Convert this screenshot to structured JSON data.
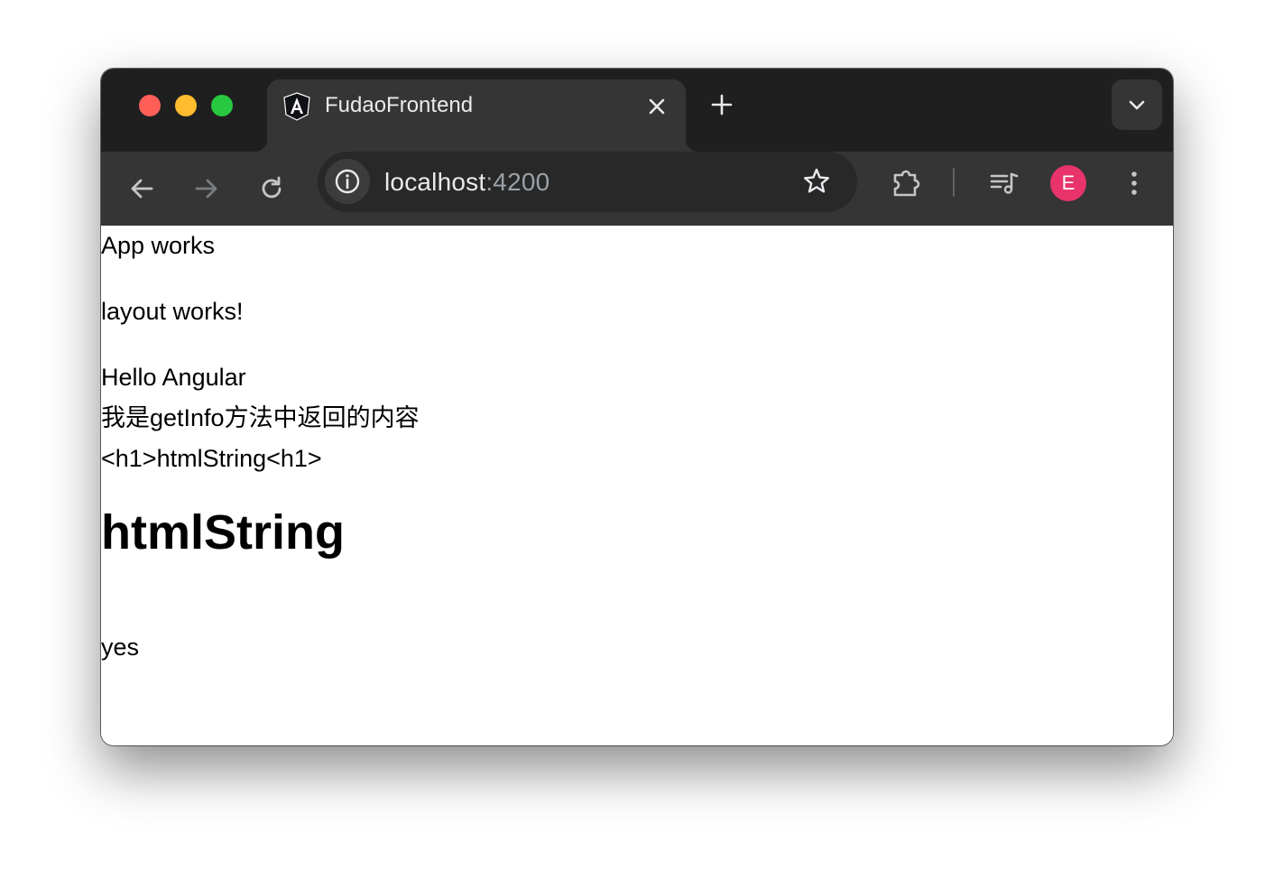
{
  "browser": {
    "tab": {
      "title": "FudaoFrontend",
      "favicon": "angular-logo-icon"
    },
    "address_bar": {
      "host": "localhost",
      "port": ":4200"
    },
    "profile_initial": "E",
    "colors": {
      "tabstrip": "#1f1f1f",
      "toolbar": "#353535",
      "omnibox": "#282828",
      "avatar": "#e8336b",
      "close": "#ff5f57",
      "minimize": "#febc2e",
      "maximize": "#28c840"
    }
  },
  "page": {
    "app_text": "App works",
    "layout_text": "layout works!",
    "hello_text": "Hello Angular",
    "info_text": "我是getInfo方法中返回的内容",
    "raw_html_text": "<h1>htmlString<h1>",
    "heading_text": "htmlString",
    "yes_text": "yes"
  }
}
